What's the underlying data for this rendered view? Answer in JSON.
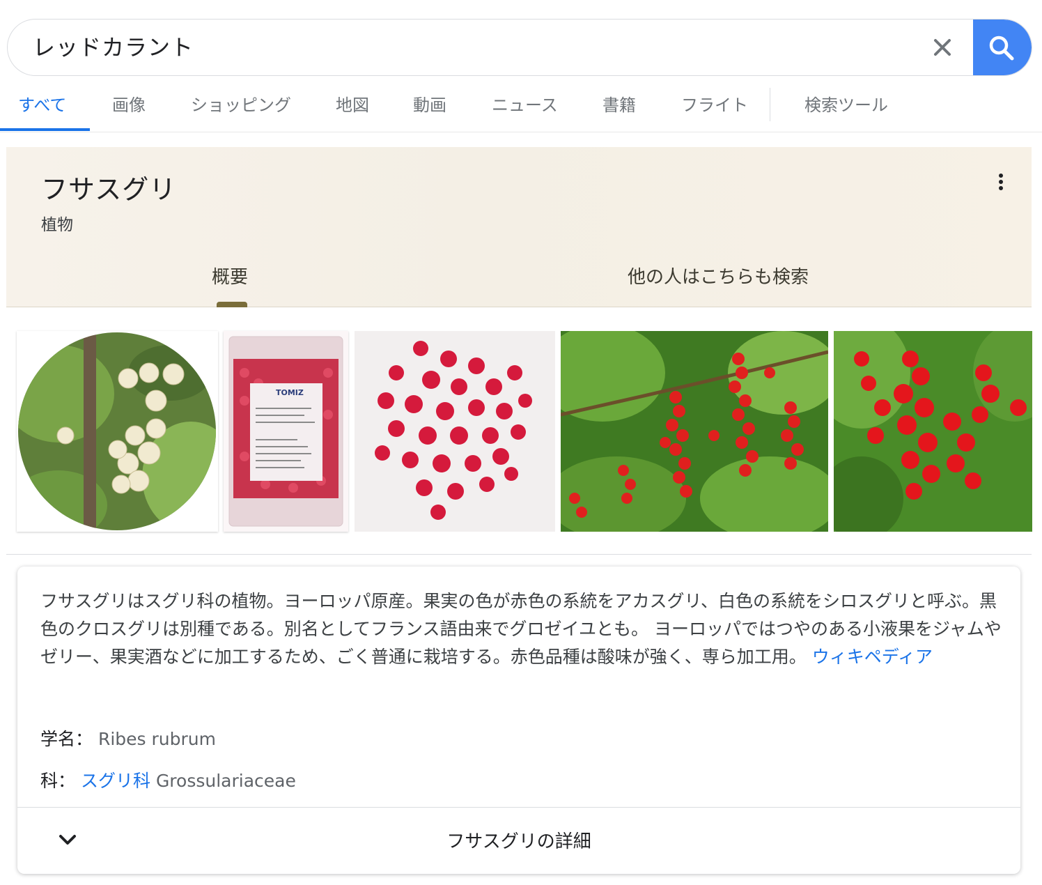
{
  "search": {
    "query": "レッドカラント",
    "clear_icon": "close-icon",
    "search_icon": "search-icon",
    "accent_color": "#4285f4"
  },
  "tabs": [
    {
      "label": "すべて",
      "active": true
    },
    {
      "label": "画像"
    },
    {
      "label": "ショッピング"
    },
    {
      "label": "地図"
    },
    {
      "label": "動画"
    },
    {
      "label": "ニュース"
    },
    {
      "label": "書籍"
    },
    {
      "label": "フライト"
    },
    {
      "label": "検索ツール"
    }
  ],
  "knowledge_panel": {
    "title": "フサスグリ",
    "subtitle": "植物",
    "more_icon": "more-vert-icon",
    "tabs": [
      {
        "label": "概要",
        "active": true
      },
      {
        "label": "他の人はこちらも検索"
      }
    ]
  },
  "images": [
    {
      "subject": "white-currant-photo"
    },
    {
      "subject": "frozen-redcurrant-package-photo",
      "brand": "TOMIZ"
    },
    {
      "subject": "redcurrant-bunches-photo"
    },
    {
      "subject": "redcurrant-bush-photo"
    },
    {
      "subject": "redcurrant-closeup-photo"
    }
  ],
  "description": {
    "text": "フサスグリはスグリ科の植物。ヨーロッパ原産。果実の色が赤色の系統をアカスグリ、白色の系統をシロスグリと呼ぶ。黒色のクロスグリは別種である。別名としてフランス語由来でグロゼイユとも。 ヨーロッパではつやのある小液果をジャムやゼリー、果実酒などに加工するため、ごく普通に栽培する。赤色品種は酸味が強く、専ら加工用。",
    "source_link": "ウィキペディア",
    "facts": [
      {
        "label": "学名：",
        "value": "Ribes rubrum"
      },
      {
        "label": "科：",
        "link": "スグリ科",
        "value": "Grossulariaceae"
      }
    ],
    "expand_label": "フサスグリの詳細",
    "expand_icon": "chevron-down-icon"
  }
}
